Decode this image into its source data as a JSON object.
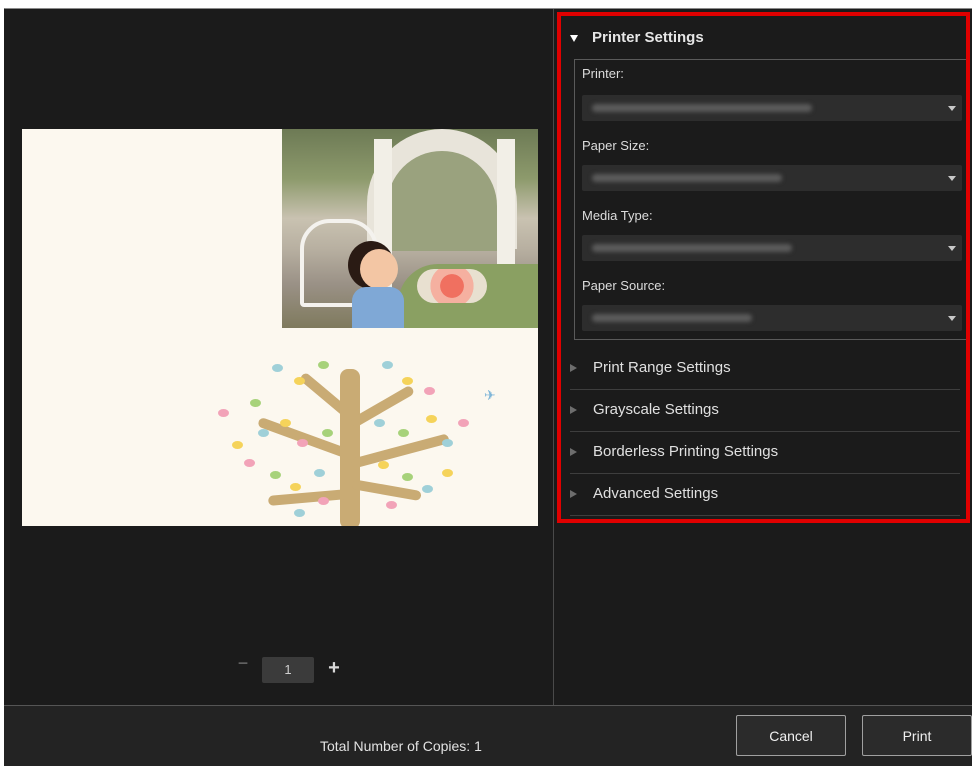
{
  "settings": {
    "printer_settings": {
      "title": "Printer Settings",
      "printer_label": "Printer:",
      "paper_size_label": "Paper Size:",
      "media_type_label": "Media Type:",
      "paper_source_label": "Paper Source:"
    },
    "collapsed_sections": [
      {
        "label": "Print Range Settings"
      },
      {
        "label": "Grayscale Settings"
      },
      {
        "label": "Borderless Printing Settings"
      },
      {
        "label": "Advanced Settings"
      }
    ]
  },
  "page_nav": {
    "minus": "−",
    "page": "1",
    "plus": "+"
  },
  "footer": {
    "total_copies_label": "Total Number of Copies: 1",
    "cancel_label": "Cancel",
    "print_label": "Print"
  },
  "colors": {
    "highlight_border": "#e00000",
    "panel_background": "#1b1b1b"
  },
  "icons": {
    "expand": "triangle-down-icon",
    "collapse": "triangle-right-icon",
    "dropdown": "chevron-down-icon"
  }
}
